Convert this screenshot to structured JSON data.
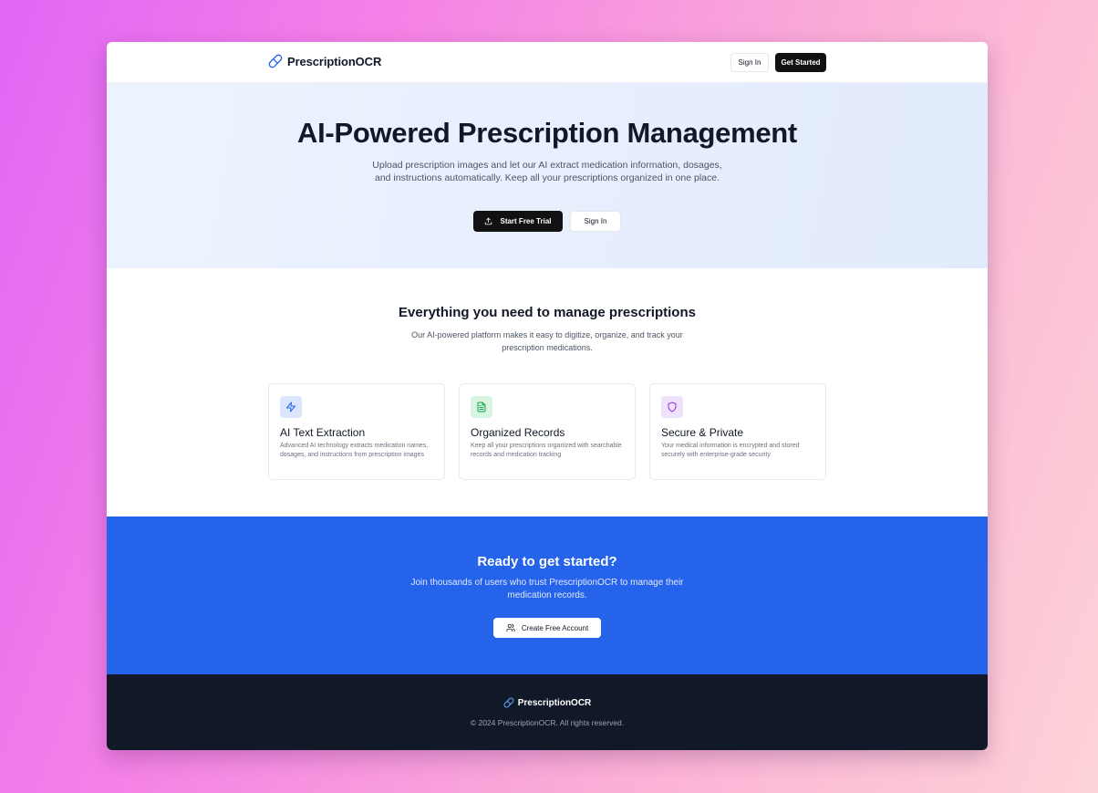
{
  "header": {
    "brand": "PrescriptionOCR",
    "brand_icon": "pill-icon",
    "sign_in": "Sign In",
    "get_started": "Get Started"
  },
  "hero": {
    "title": "AI-Powered Prescription Management",
    "subtitle": "Upload prescription images and let our AI extract medication information, dosages, and instructions automatically. Keep all your prescriptions organized in one place.",
    "primary_button": "Start Free Trial",
    "primary_icon": "upload-icon",
    "secondary_button": "Sign In"
  },
  "features": {
    "title": "Everything you need to manage prescriptions",
    "subtitle": "Our AI-powered platform makes it easy to digitize, organize, and track your prescription medications.",
    "cards": [
      {
        "title": "AI Text Extraction",
        "description": "Advanced AI technology extracts medication names, dosages, and instructions from prescription images",
        "icon": "lightning-icon",
        "icon_bg": "#dbe6fd",
        "icon_color": "#2563eb"
      },
      {
        "title": "Organized Records",
        "description": "Keep all your prescriptions organized with searchable records and medication tracking",
        "icon": "document-icon",
        "icon_bg": "#d7f5e0",
        "icon_color": "#16a34a"
      },
      {
        "title": "Secure & Private",
        "description": "Your medical information is encrypted and stored securely with enterprise-grade security",
        "icon": "shield-icon",
        "icon_bg": "#f1e2fc",
        "icon_color": "#9333ea"
      }
    ]
  },
  "cta": {
    "title": "Ready to get started?",
    "subtitle": "Join thousands of users who trust PrescriptionOCR to manage their medication records.",
    "button": "Create Free Account",
    "button_icon": "users-icon"
  },
  "footer": {
    "brand": "PrescriptionOCR",
    "copyright": "© 2024 PrescriptionOCR. All rights reserved."
  },
  "colors": {
    "accent": "#2563eb",
    "dark": "#111111",
    "footer": "#111827"
  }
}
